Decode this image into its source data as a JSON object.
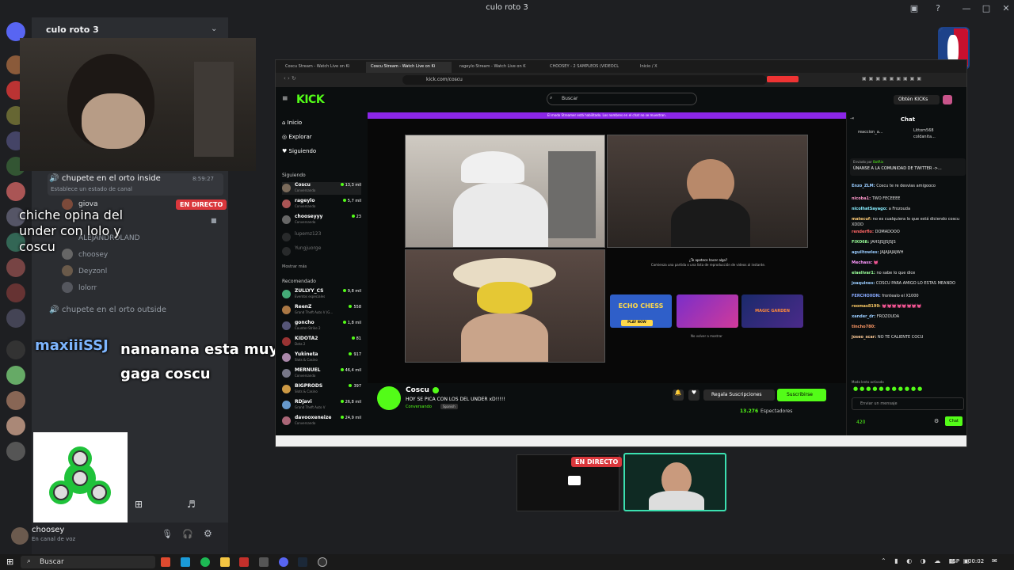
{
  "app": {
    "title": "culo roto 3",
    "server_name": "culo roto 3"
  },
  "channels": [
    {
      "name": "chupete en el orto inside",
      "time": "8:59:27",
      "status_hint": "Establece un estado de canal",
      "live": "EN DIRECTO",
      "members": [
        "giova",
        "choosey",
        "Deyzonl",
        "lolorr"
      ],
      "member_hidden": "ALEJANDROLAND"
    },
    {
      "name": "chupete en el orto outside"
    }
  ],
  "captions": {
    "top": "chiche opina del under con lolo y coscu",
    "chat_user": "maxiiiSSJ",
    "chat_text": "nananana esta muy gaga coscu"
  },
  "user": {
    "name": "choosey",
    "status": "En canal de voz"
  },
  "browser": {
    "tabs": [
      "Coscu Stream - Watch Live on Ki",
      "Coscu Stream - Watch Live on Ki",
      "rageylo Stream - Watch Live on K",
      "CHOOSEY - 2 SAMPLEOS (VIDEOCL",
      "Inicio / X"
    ],
    "url": "kick.com/coscu",
    "logo": "KICK",
    "search_placeholder": "Buscar",
    "get_kicks": "Obtén KICKs",
    "nav": [
      "Inicio",
      "Explorar",
      "Siguiendo"
    ],
    "following_title": "Siguiendo",
    "following": [
      {
        "name": "Coscu",
        "sub": "Conversando",
        "viewers": "13,3 mil"
      },
      {
        "name": "rageylo",
        "sub": "Conversando",
        "viewers": "5,7 mil"
      },
      {
        "name": "chooseyyy",
        "sub": "Conversando",
        "viewers": "23"
      },
      {
        "name": "lupemz123",
        "sub": "",
        "viewers": ""
      },
      {
        "name": "Yungjuorge",
        "sub": "",
        "viewers": ""
      }
    ],
    "show_more": "Mostrar más",
    "recommended_title": "Recomendado",
    "recommended": [
      {
        "name": "ZULLYY_CS",
        "sub": "Eventos especiales",
        "viewers": "9,8 mil"
      },
      {
        "name": "ReenZ",
        "sub": "Grand Theft Auto V (G...",
        "viewers": "558"
      },
      {
        "name": "goncho",
        "sub": "Counter-Strike 2",
        "viewers": "1,8 mil"
      },
      {
        "name": "KIDOTA2",
        "sub": "Dota 2",
        "viewers": "81"
      },
      {
        "name": "Yukineta",
        "sub": "Slots & Casino",
        "viewers": "917"
      },
      {
        "name": "MERNUEL",
        "sub": "Conversando",
        "viewers": "46,4 mil"
      },
      {
        "name": "BIGPRODS",
        "sub": "Slots & Casino",
        "viewers": "397"
      },
      {
        "name": "RDjavi",
        "sub": "Grand Theft Auto V",
        "viewers": "26,8 mil"
      },
      {
        "name": "davooxeneize",
        "sub": "Conversando",
        "viewers": "24,9 mil"
      }
    ],
    "banner": "El modo Streamer está habilitado. Los nombres en el chat no se muestran.",
    "game_prompt": "¿Te apetece hacer algo?",
    "game_sub": "Comienza una partida o una lista de reproducción de videos al instante.",
    "games": [
      "ECHO CHESS",
      "",
      "MAGIC GARDEN"
    ],
    "play_now": "PLAY NOW",
    "no_show": "No volver a mostrar",
    "streamer": "Coscu",
    "stream_title": "HOY SE PICA CON LOS DEL UNDER xD!!!!!",
    "category": "Conversando",
    "lang": "Spanish",
    "gift": "Regala Suscripciones",
    "subscribe": "Suscribirse",
    "viewers": "13.276",
    "viewers_label": "Espectadores",
    "chat_title": "Chat",
    "pinned": [
      "reaccion_a...",
      "Littom568",
      "coldanita..."
    ],
    "pinned_note": "Enviado por",
    "pinned_by": "BotRix",
    "pinned_msg": "ÚNANSE A LA COMUNIDAD DE TWITTER ->...",
    "messages": [
      {
        "user": "Enzo_ZLM:",
        "text": "Coscu te re desvias amigooco",
        "color": "#9cf"
      },
      {
        "user": "nicoba1:",
        "text": "TWO FECEEEE",
        "color": "#f9c"
      },
      {
        "user": "nicolhatSayago:",
        "text": "a Frozouda",
        "color": "#8ef"
      },
      {
        "user": "matecuf:",
        "text": "no es cualquiera lo que está diciendo coscu XDDD",
        "color": "#fc7"
      },
      {
        "user": "renderflo:",
        "text": "DOMADOOO",
        "color": "#f66"
      },
      {
        "user": "FIXO6ß:",
        "text": "JAHSJSJJSJSJS",
        "color": "#9f9"
      },
      {
        "user": "aguiltowles:",
        "text": "JAJAJAJAJWH",
        "color": "#9cf"
      },
      {
        "user": "Mechass:",
        "text": "💓",
        "color": "#f9f"
      },
      {
        "user": "elaelivar1:",
        "text": "no sabe lo que dice",
        "color": "#9f9"
      },
      {
        "user": "joaquines:",
        "text": "COSCU PARA AMIGO LO ESTAS MEANDO",
        "color": "#9cf"
      },
      {
        "user": "FERCHOXON:",
        "text": "frontealo el X1000",
        "color": "#8af"
      },
      {
        "user": "roomas8199:",
        "text": "💓💓💓💓💓💓💓💓",
        "color": "#fc6"
      },
      {
        "user": "xander_dr:",
        "text": "FROZOUDA",
        "color": "#9cf"
      },
      {
        "user": "tincho780:",
        "text": "",
        "color": "#f96"
      },
      {
        "user": "joseo_scar:",
        "text": "NO TE CALIENTE COCU",
        "color": "#fc9"
      }
    ],
    "slow_mode": "Modo lento activado",
    "chat_placeholder": "Enviar un mensaje",
    "points": "420",
    "chat_btn": "Chat"
  },
  "preview": {
    "live": "EN DIRECTO"
  },
  "taskbar": {
    "search": "Buscar",
    "lang": "ESP",
    "time": "00:02"
  }
}
